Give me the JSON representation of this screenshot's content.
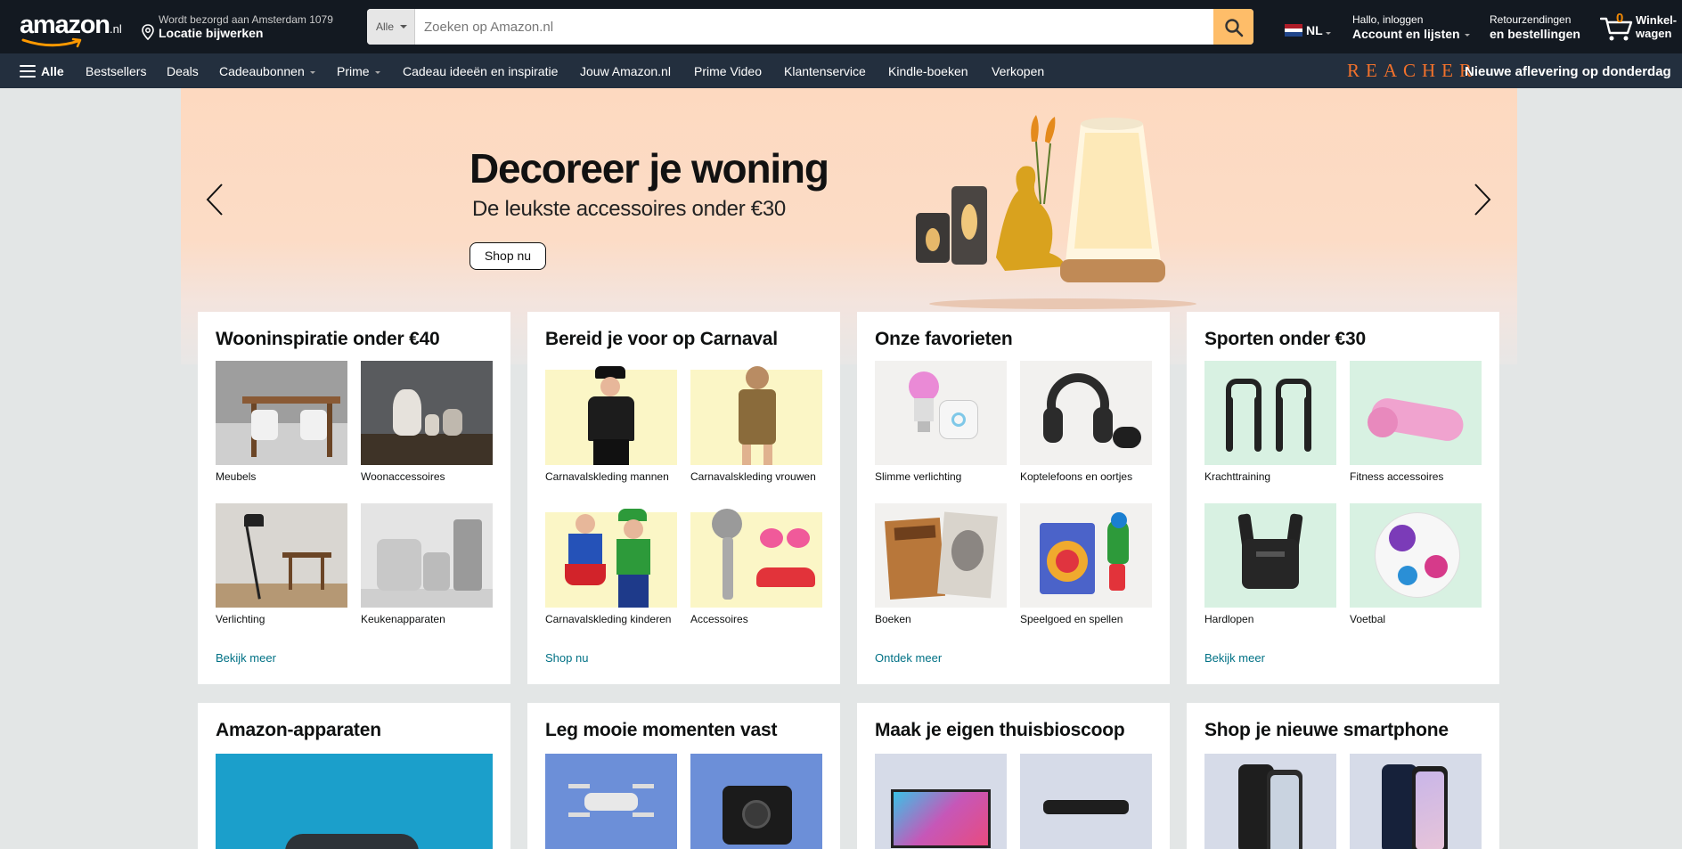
{
  "header": {
    "logo_text": "amazon",
    "logo_tld": ".nl",
    "deliver_line1": "Wordt bezorgd aan Amsterdam 1079",
    "deliver_line2": "Locatie bijwerken",
    "search": {
      "category": "Alle",
      "placeholder": "Zoeken op Amazon.nl"
    },
    "language": "NL",
    "account_line1": "Hallo, inloggen",
    "account_line2": "Account en lijsten",
    "returns_line1": "Retourzendingen",
    "returns_line2": "en bestellingen",
    "cart_count": "0",
    "cart_line1": "Winkel-",
    "cart_line2": "wagen",
    "colors": {
      "nav_bg": "#131921",
      "subnav_bg": "#232f3e",
      "search_button": "#febd69",
      "accent": "#f08804"
    }
  },
  "subnav": {
    "all_label": "Alle",
    "items": [
      "Bestsellers",
      "Deals",
      "Cadeaubonnen",
      "Prime",
      "Cadeau ideeën en inspiratie",
      "Jouw Amazon.nl",
      "Prime Video",
      "Klantenservice",
      "Kindle-boeken",
      "Verkopen"
    ],
    "promo_brand": "REACHER",
    "promo_text": "Nieuwe aflevering op donderdag"
  },
  "hero": {
    "title": "Decoreer je woning",
    "subtitle": "De leukste accessoires onder €30",
    "cta": "Shop nu"
  },
  "cards": [
    {
      "title": "Wooninspiratie onder €40",
      "tiles": [
        "Meubels",
        "Woonaccessoires",
        "Verlichting",
        "Keukenapparaten"
      ],
      "link": "Bekijk meer"
    },
    {
      "title": "Bereid je voor op Carnaval",
      "tiles": [
        "Carnavalskleding mannen",
        "Carnavalskleding vrouwen",
        "Carnavalskleding kinderen",
        "Accessoires"
      ],
      "link": "Shop nu"
    },
    {
      "title": "Onze favorieten",
      "tiles": [
        "Slimme verlichting",
        "Koptelefoons en oortjes",
        "Boeken",
        "Speelgoed en spellen"
      ],
      "link": "Ontdek meer"
    },
    {
      "title": "Sporten onder €30",
      "tiles": [
        "Krachttraining",
        "Fitness accessoires",
        "Hardlopen",
        "Voetbal"
      ],
      "link": "Bekijk meer"
    }
  ],
  "cards_row2": [
    {
      "title": "Amazon-apparaten"
    },
    {
      "title": "Leg mooie momenten vast"
    },
    {
      "title": "Maak je eigen thuisbioscoop"
    },
    {
      "title": "Shop je nieuwe smartphone"
    }
  ]
}
